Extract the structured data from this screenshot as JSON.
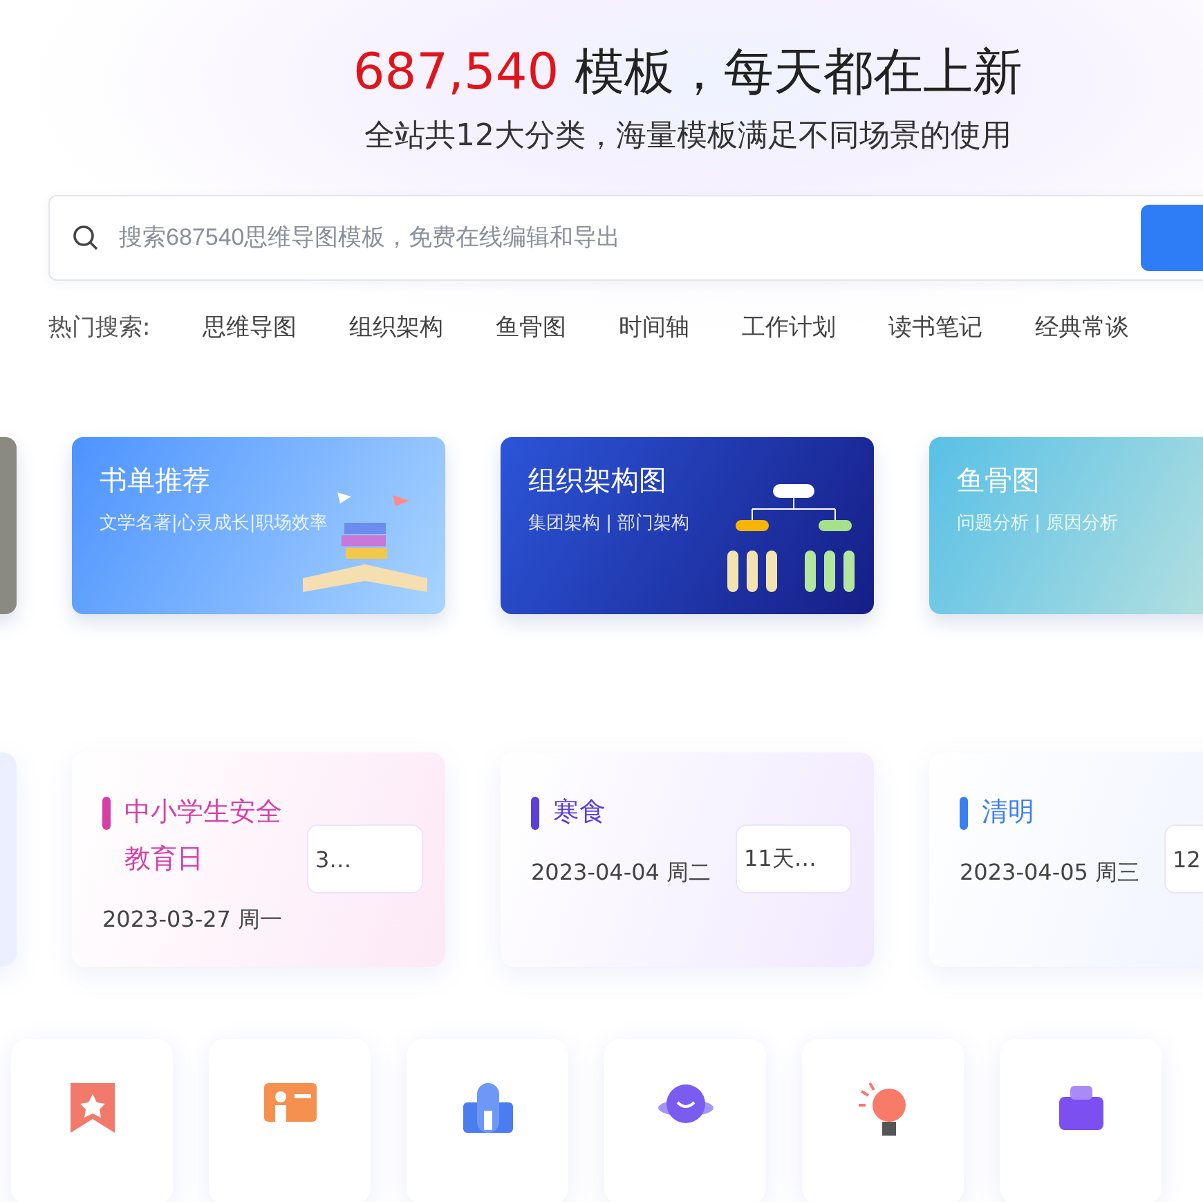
{
  "headline": {
    "count": "687,540",
    "text": "模板，每天都在上新"
  },
  "subtitle": "全站共12大分类，海量模板满足不同场景的使用",
  "search": {
    "placeholder": "搜索687540思维导图模板，免费在线编辑和导出"
  },
  "hot_searches": {
    "label": "热门搜索:",
    "items": [
      "思维导图",
      "组织架构",
      "鱼骨图",
      "时间轴",
      "工作计划",
      "读书笔记",
      "经典常谈"
    ]
  },
  "banners": [
    {
      "kind": "photo"
    },
    {
      "kind": "books",
      "title": "书单推荐",
      "subtitle": "文学名著|心灵成长|职场效率"
    },
    {
      "kind": "org",
      "title": "组织架构图",
      "subtitle": "集团架构 | 部门架构"
    },
    {
      "kind": "fishbone",
      "title": "鱼骨图",
      "subtitle": "问题分析 | 原因分析"
    }
  ],
  "festivals": [
    {
      "kind": "blank"
    },
    {
      "kind": "event",
      "title": "中小学生安全教育日",
      "date": "2023-03-27 周一",
      "countdown": "3…",
      "color": "#d63fa8"
    },
    {
      "kind": "event",
      "title": "寒食",
      "date": "2023-04-04 周二",
      "countdown": "11天…",
      "color": "#5b3fd6"
    },
    {
      "kind": "event",
      "title": "清明",
      "date": "2023-04-05 周三",
      "countdown": "12",
      "color": "#3a7ff0"
    }
  ],
  "categories": [
    {
      "kind": "bookmark"
    },
    {
      "kind": "presenter"
    },
    {
      "kind": "building"
    },
    {
      "kind": "planet"
    },
    {
      "kind": "bulb"
    },
    {
      "kind": "box"
    }
  ]
}
